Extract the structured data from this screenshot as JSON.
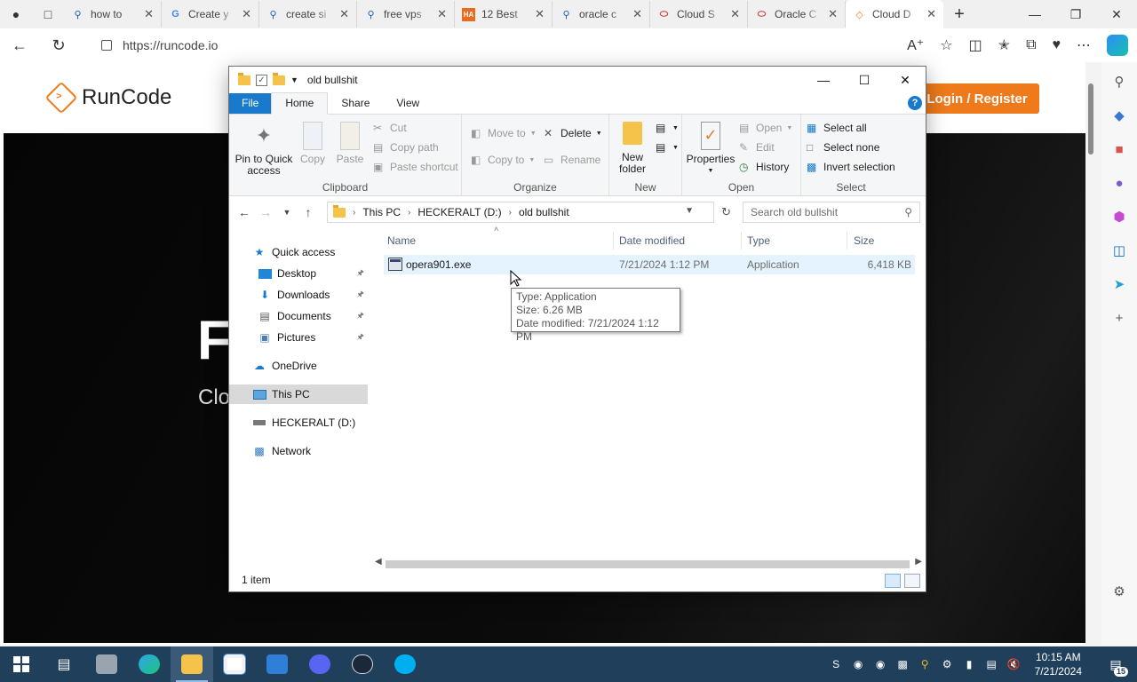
{
  "browser": {
    "tabs": [
      {
        "title": "how to",
        "icon": "search-icon",
        "active": false
      },
      {
        "title": "Create y",
        "icon": "google-icon",
        "active": false
      },
      {
        "title": "create si",
        "icon": "search-icon",
        "active": false
      },
      {
        "title": "free vps",
        "icon": "search-icon",
        "active": false
      },
      {
        "title": "12 Best",
        "icon": "ha-icon",
        "active": false
      },
      {
        "title": "oracle c",
        "icon": "search-icon",
        "active": false
      },
      {
        "title": "Cloud S",
        "icon": "oracle-icon",
        "active": false
      },
      {
        "title": "Oracle C",
        "icon": "oracle-icon",
        "active": false
      },
      {
        "title": "Cloud D",
        "icon": "runcode-icon",
        "active": true
      }
    ],
    "url": "https://runcode.io"
  },
  "webpage": {
    "brand": "RunCode",
    "login_button": "Login / Register",
    "hero_title": "F",
    "hero_subtitle": "Clo"
  },
  "explorer": {
    "title": "old bullshit",
    "ribbon_tabs": [
      "File",
      "Home",
      "Share",
      "View"
    ],
    "active_tab": "Home",
    "clipboard": {
      "pin": "Pin to Quick access",
      "copy": "Copy",
      "paste": "Paste",
      "cut": "Cut",
      "copy_path": "Copy path",
      "paste_shortcut": "Paste shortcut",
      "label": "Clipboard"
    },
    "organize": {
      "move_to": "Move to",
      "copy_to": "Copy to",
      "delete": "Delete",
      "rename": "Rename",
      "label": "Organize"
    },
    "new": {
      "new_folder": "New folder",
      "label": "New"
    },
    "open": {
      "properties": "Properties",
      "open": "Open",
      "edit": "Edit",
      "history": "History",
      "label": "Open"
    },
    "select": {
      "select_all": "Select all",
      "select_none": "Select none",
      "invert_selection": "Invert selection",
      "label": "Select"
    },
    "breadcrumb": [
      "This PC",
      "HECKERALT (D:)",
      "old bullshit"
    ],
    "search_placeholder": "Search old bullshit",
    "nav": [
      {
        "label": "Quick access",
        "icon": "star-icon",
        "pinned": false
      },
      {
        "label": "Desktop",
        "icon": "desktop-icon",
        "pinned": true
      },
      {
        "label": "Downloads",
        "icon": "download-icon",
        "pinned": true
      },
      {
        "label": "Documents",
        "icon": "document-icon",
        "pinned": true
      },
      {
        "label": "Pictures",
        "icon": "picture-icon",
        "pinned": true
      },
      {
        "label": "OneDrive",
        "icon": "cloud-icon",
        "pinned": false
      },
      {
        "label": "This PC",
        "icon": "computer-icon",
        "pinned": false
      },
      {
        "label": "HECKERALT (D:)",
        "icon": "drive-icon",
        "pinned": false
      },
      {
        "label": "Network",
        "icon": "network-icon",
        "pinned": false
      }
    ],
    "columns": [
      "Name",
      "Date modified",
      "Type",
      "Size"
    ],
    "files": [
      {
        "name": "opera901.exe",
        "date": "7/21/2024 1:12 PM",
        "type": "Application",
        "size": "6,418 KB"
      }
    ],
    "tooltip": {
      "type": "Type: Application",
      "size": "Size: 6.26 MB",
      "date": "Date modified: 7/21/2024 1:12 PM"
    },
    "status": "1 item"
  },
  "taskbar": {
    "time": "10:15 AM",
    "date": "7/21/2024",
    "notifications": "15"
  },
  "colors": {
    "accent": "#1979ca",
    "brand_orange": "#ee7a1c",
    "taskbar": "#1f3f5b"
  }
}
